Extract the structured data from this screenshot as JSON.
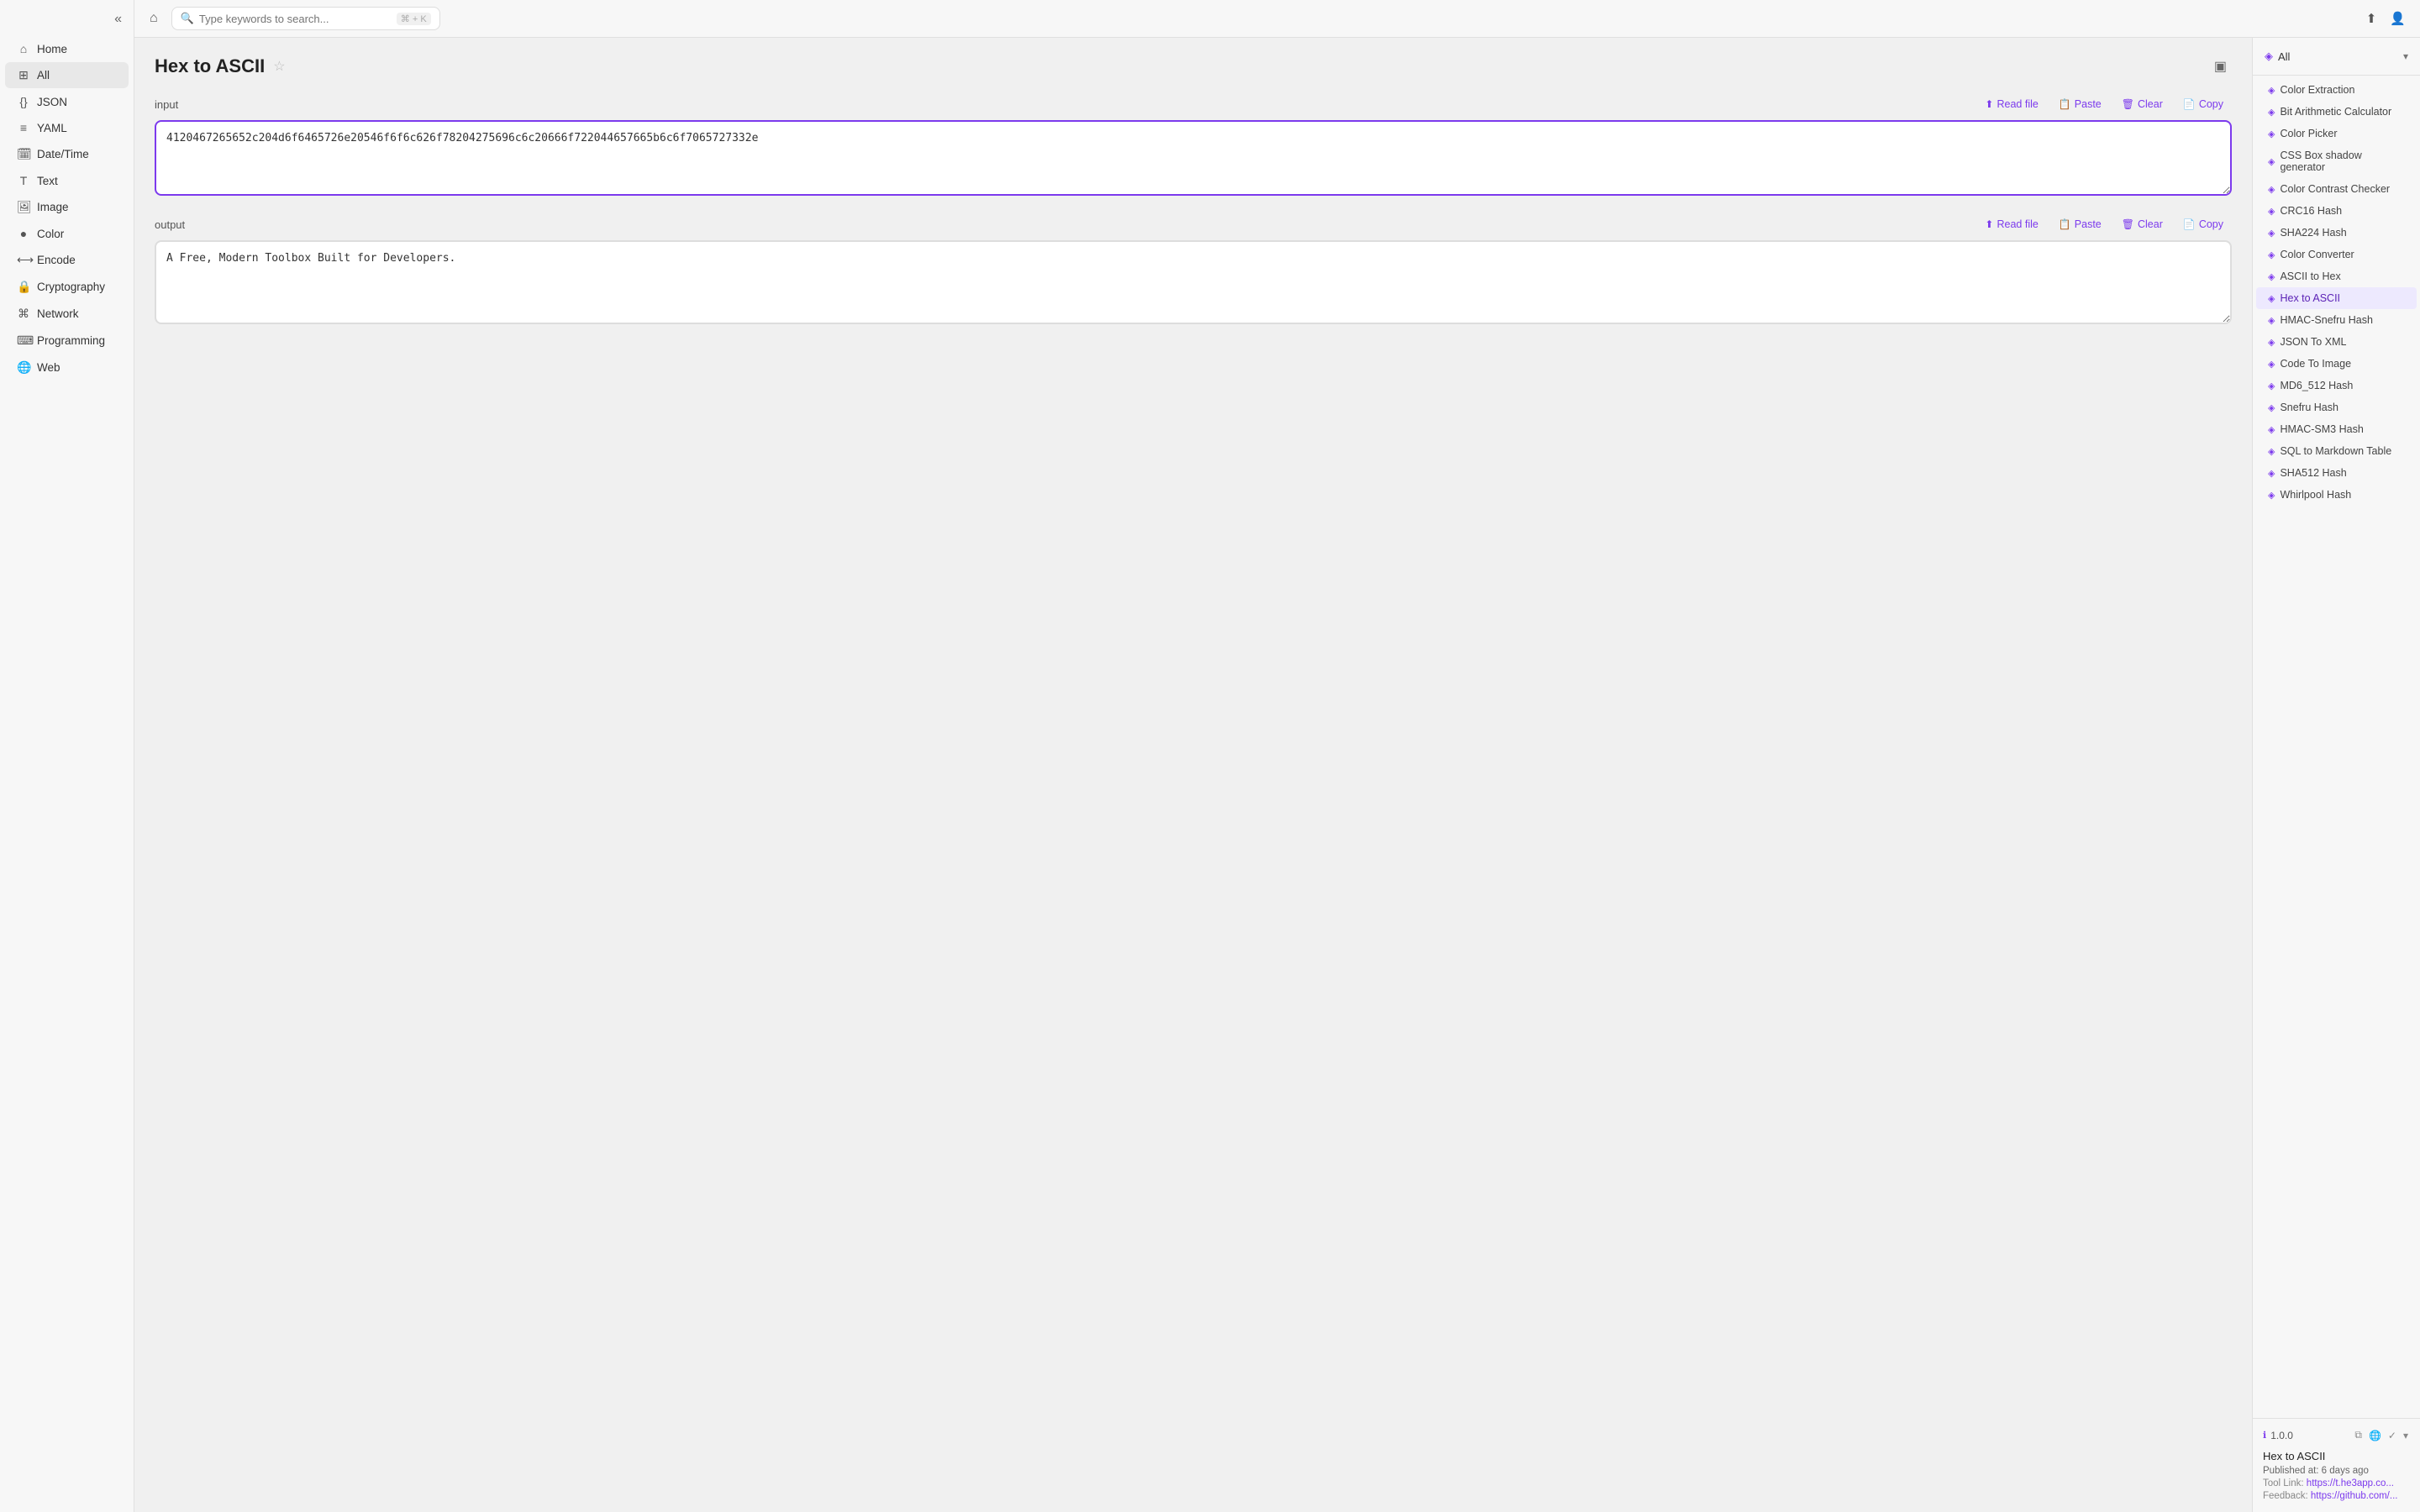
{
  "sidebar": {
    "toggle_icon": "«",
    "items": [
      {
        "id": "home",
        "label": "Home",
        "icon": "⌂"
      },
      {
        "id": "all",
        "label": "All",
        "icon": "⊞",
        "active": true
      },
      {
        "id": "json",
        "label": "JSON",
        "icon": "{}"
      },
      {
        "id": "yaml",
        "label": "YAML",
        "icon": "≡"
      },
      {
        "id": "datetime",
        "label": "Date/Time",
        "icon": "🗓"
      },
      {
        "id": "text",
        "label": "Text",
        "icon": "T"
      },
      {
        "id": "image",
        "label": "Image",
        "icon": "🖼"
      },
      {
        "id": "color",
        "label": "Color",
        "icon": "●"
      },
      {
        "id": "encode",
        "label": "Encode",
        "icon": "⟷"
      },
      {
        "id": "cryptography",
        "label": "Cryptography",
        "icon": "🔒"
      },
      {
        "id": "network",
        "label": "Network",
        "icon": "⌘"
      },
      {
        "id": "programming",
        "label": "Programming",
        "icon": "⌨"
      },
      {
        "id": "web",
        "label": "Web",
        "icon": "🌐"
      }
    ]
  },
  "topbar": {
    "home_icon": "⌂",
    "search_placeholder": "Type keywords to search...",
    "search_shortcut": "⌘ + K",
    "share_icon": "↑",
    "user_icon": "👤"
  },
  "tool": {
    "title": "Hex to ASCII",
    "star_icon": "☆",
    "panel_toggle_icon": "▣"
  },
  "input_section": {
    "label": "input",
    "value": "4120467265652c204d6f6465726e20546f6f6c626f78204275696c6c20666f722044657665b6c6f7065727332e",
    "read_file_label": "Read file",
    "paste_label": "Paste",
    "clear_label": "Clear",
    "copy_label": "Copy"
  },
  "output_section": {
    "label": "output",
    "value": "A Free, Modern Toolbox Built for Developers.",
    "read_file_label": "Read file",
    "paste_label": "Paste",
    "clear_label": "Clear",
    "copy_label": "Copy"
  },
  "right_panel": {
    "filter_label": "All",
    "filter_icon": "◈",
    "chevron_icon": "▾",
    "items": [
      {
        "id": "color-extraction",
        "label": "Color Extraction",
        "active": false
      },
      {
        "id": "bit-arithmetic",
        "label": "Bit Arithmetic Calculator",
        "active": false
      },
      {
        "id": "color-picker",
        "label": "Color Picker",
        "active": false
      },
      {
        "id": "css-box-shadow",
        "label": "CSS Box shadow generator",
        "active": false
      },
      {
        "id": "color-contrast",
        "label": "Color Contrast Checker",
        "active": false
      },
      {
        "id": "crc16-hash",
        "label": "CRC16 Hash",
        "active": false
      },
      {
        "id": "sha224-hash",
        "label": "SHA224 Hash",
        "active": false
      },
      {
        "id": "color-converter",
        "label": "Color Converter",
        "active": false
      },
      {
        "id": "ascii-to-hex",
        "label": "ASCII to Hex",
        "active": false
      },
      {
        "id": "hex-to-ascii",
        "label": "Hex to ASCII",
        "active": true
      },
      {
        "id": "hmac-snefru",
        "label": "HMAC-Snefru Hash",
        "active": false
      },
      {
        "id": "json-to-xml",
        "label": "JSON To XML",
        "active": false
      },
      {
        "id": "code-to-image",
        "label": "Code To Image",
        "active": false
      },
      {
        "id": "md6-512-hash",
        "label": "MD6_512 Hash",
        "active": false
      },
      {
        "id": "snefru-hash",
        "label": "Snefru Hash",
        "active": false
      },
      {
        "id": "hmac-sm3",
        "label": "HMAC-SM3 Hash",
        "active": false
      },
      {
        "id": "sql-markdown",
        "label": "SQL to Markdown Table",
        "active": false
      },
      {
        "id": "sha512-hash",
        "label": "SHA512 Hash",
        "active": false
      },
      {
        "id": "whirlpool-hash",
        "label": "Whirlpool Hash",
        "active": false
      }
    ],
    "bottom": {
      "version": "1.0.0",
      "version_icon": "ℹ",
      "icons": [
        "⧉",
        "🌐",
        "✓"
      ],
      "title": "Hex to ASCII",
      "published": "Published at: 6 days ago",
      "tool_link_label": "Tool Link:",
      "tool_link_url": "https://t.he3app.co...",
      "feedback_label": "Feedback:",
      "feedback_url": "https://github.com/..."
    }
  }
}
